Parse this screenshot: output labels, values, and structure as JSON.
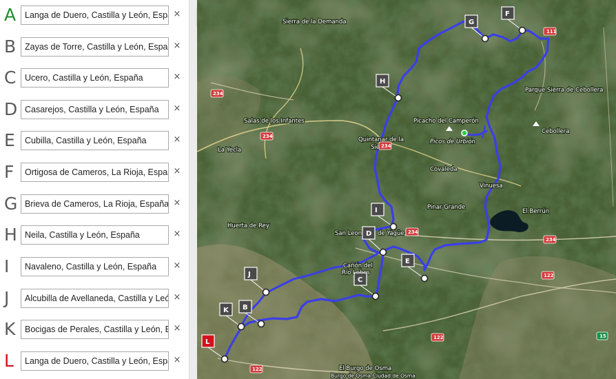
{
  "waypoints": [
    {
      "letter": "A",
      "value": "Langa de Duero, Castilla y León, España",
      "color": "#1e8f2e"
    },
    {
      "letter": "B",
      "value": "Zayas de Torre, Castilla y León, España",
      "color": "#5a5a5a"
    },
    {
      "letter": "C",
      "value": "Ucero, Castilla y León, España",
      "color": "#5a5a5a"
    },
    {
      "letter": "D",
      "value": "Casarejos, Castilla y León, España",
      "color": "#5a5a5a"
    },
    {
      "letter": "E",
      "value": "Cubilla, Castilla y León, España",
      "color": "#5a5a5a"
    },
    {
      "letter": "F",
      "value": "Ortigosa de Cameros, La Rioja, España",
      "color": "#5a5a5a"
    },
    {
      "letter": "G",
      "value": "Brieva de Cameros, La Rioja, España",
      "color": "#5a5a5a"
    },
    {
      "letter": "H",
      "value": "Neila, Castilla y León, España",
      "color": "#5a5a5a"
    },
    {
      "letter": "I",
      "value": "Navaleno, Castilla y León, España",
      "color": "#5a5a5a"
    },
    {
      "letter": "J",
      "value": "Alcubilla de Avellaneda, Castilla y León, España",
      "color": "#5a5a5a"
    },
    {
      "letter": "K",
      "value": "Bocigas de Perales, Castilla y León, España",
      "color": "#5a5a5a"
    },
    {
      "letter": "L",
      "value": "Langa de Duero, Castilla y León, España",
      "color": "#d0121b"
    }
  ],
  "remove_symbol": "×",
  "map_labels": {
    "sierra_demanda": "Sierra de la Demanda",
    "salas": "Salas de los Infantes",
    "la_yecla": "La Yecla",
    "picacho": "Picacho del Camperón",
    "picos_urbion": "Picos de Urbión",
    "quintanar_1": "Quintanar de la",
    "quintanar_2": "Sierra",
    "covaleda": "Covaleda",
    "vinuesa": "Vinuesa",
    "el_berrun": "El Berrún",
    "parque_cebollera": "Parque Sierra de Cebollera",
    "cebollera": "Cebollera",
    "pinar_grande": "Pinar Grande",
    "huerta_rey": "Huerta de Rey",
    "san_leonardo_1": "San Leon",
    "san_leonardo_2": "de Yagüe",
    "canon_1": "Cañón del",
    "canon_2": "Río Lobos",
    "burgo": "El Burgo de Osma",
    "burgo_ciudad": "Burgo de Osma-Ciudad de Osma"
  },
  "road_badges": {
    "r234_a": "234",
    "r234_b": "234",
    "r234_c": "234",
    "r234_d": "234",
    "r111": "111",
    "r122_a": "122",
    "r122_b": "122",
    "r122_c": "122",
    "r15": "15"
  },
  "colors": {
    "route": "#3b3fe6",
    "marker_box": "#4a4a4a",
    "marker_box_end": "#d0121b",
    "start_letter": "#1e8f2e",
    "end_letter": "#d0121b",
    "road_badge": "#d13b3b",
    "road_badge_green": "#1e8f4a"
  }
}
